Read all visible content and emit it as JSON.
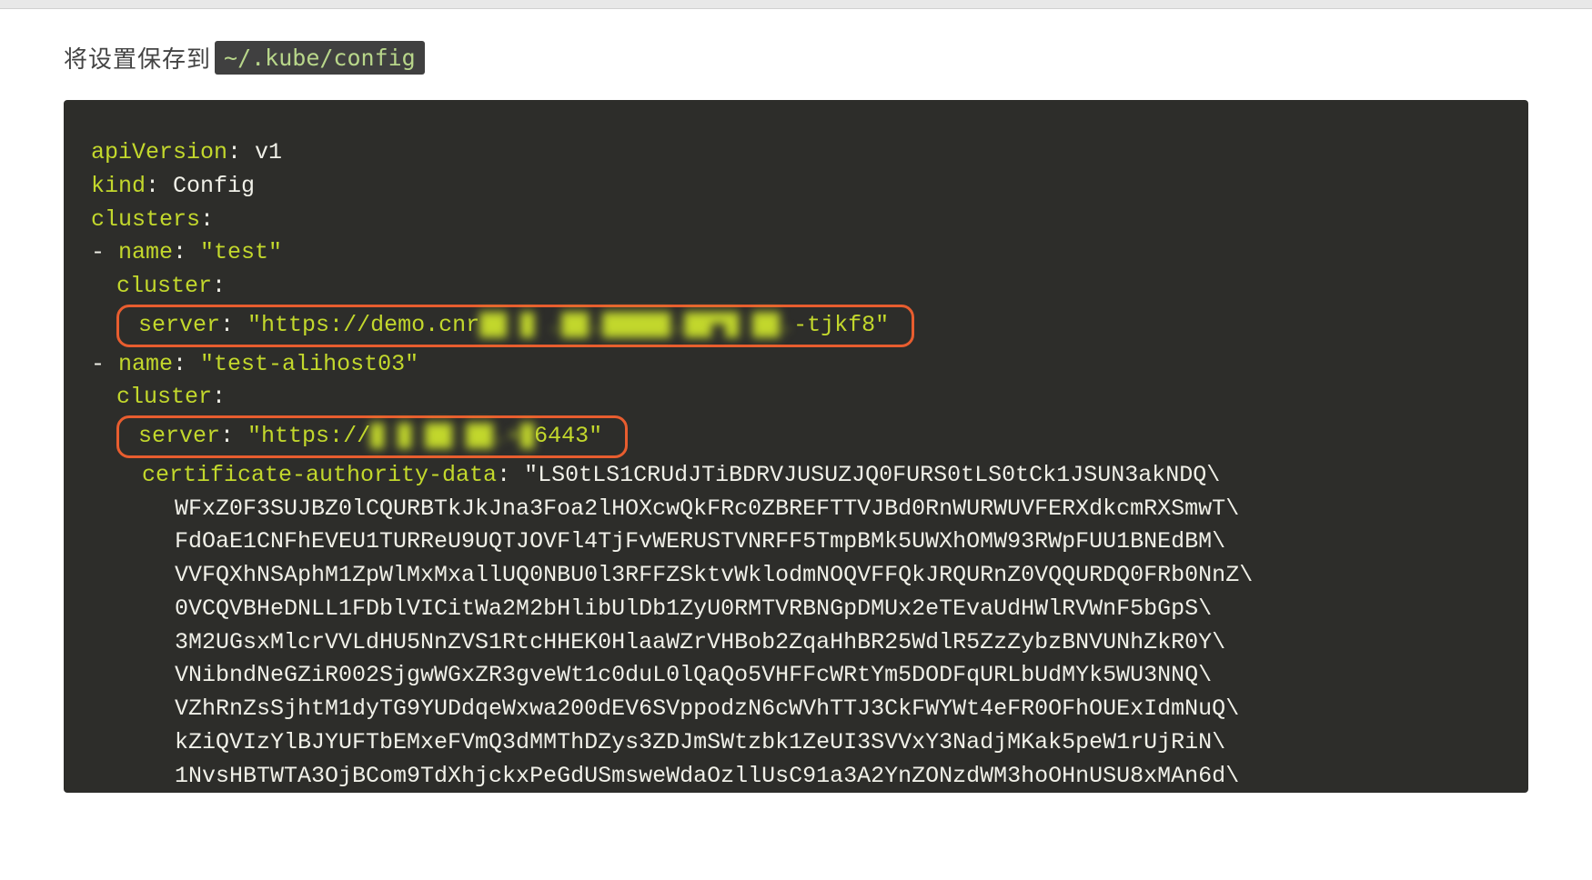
{
  "intro": {
    "text_before": "将设置保存到",
    "code": "~/.kube/config"
  },
  "yaml": {
    "apiVersion_key": "apiVersion",
    "apiVersion_value": "v1",
    "kind_key": "kind",
    "kind_value": "Config",
    "clusters_key": "clusters",
    "name_key": "name",
    "cluster_key": "cluster",
    "server_key": "server",
    "cert_key": "certificate-authority-data",
    "cluster1": {
      "name": "\"test\"",
      "server_prefix": "\"https://demo.cnr",
      "server_blurred": "██ █ .██.█████.██▀█ ██.",
      "server_suffix": "-tjkf8\""
    },
    "cluster2": {
      "name": "\"test-alihost03\"",
      "server_prefix": "\"https://",
      "server_blurred": "█ █ ██ ██.▪█",
      "server_suffix": "6443\"",
      "cert_start": "\"LS0tLS1CRUdJTiBDRVJUSUZJQ0FURS0tLS0tCk1JSUN3akNDQ\\",
      "cert_lines": [
        "WFxZ0F3SUJBZ0lCQURBTkJkJna3Foa2lHOXcwQkFRc0ZBREFTTVJBd0RnWURWUVFERXdkcmRXSmwT\\",
        "FdOaE1CNFhEVEU1TURReU9UQTJOVFl4TjFvWERUSTVNRFF5TmpBMk5UWXhOMW93RWpFUU1BNEdBM\\",
        "VVFQXhNSAphM1ZpWlMxMxallUQ0NBU0l3RFFZSktvWklodmNOQVFFQkJRQURnZ0VQQURDQ0FRb0NnZ\\",
        "0VCQVBHeDNLL1FDblVICitWa2M2bHlibUlDb1ZyU0RMTVRBNGpDMUx2eTEvaUdHWlRVWnF5bGpS\\",
        "3M2UGsxMlcrVVLdHU5NnZVS1RtcHHEK0HlaaWZrVHBob2ZqaHhBR25WdlR5ZzZybzBNVUNhZkR0Y\\",
        "VNibndNeGZiR002SjgwWGxZR3gveWt1c0duL0lQaQo5VHFFcWRtYm5DODFqURLbUdMYk5WU3NNQ\\",
        "VZhRnZsSjhtM1dyTG9YUDdqeWxwa200dEV6SVppodzN6cWVhTTJ3CkFWYWt4eFR0OFhOUExIdmNuQ\\",
        "kZiQVIzYlBJYUFTbEMxeFVmQ3dMMThDZys3ZDJmSWtzbk1ZeUI3SVVxY3NadjMKak5peW1rUjRiN\\",
        "1NvsHBTWTA3OjBCom9TdXhjckxPeGdUSmsweWdaOzllUsC91a3A2YnZONzdWM3hoOHnUSU8xMAn6d\\"
      ]
    }
  }
}
